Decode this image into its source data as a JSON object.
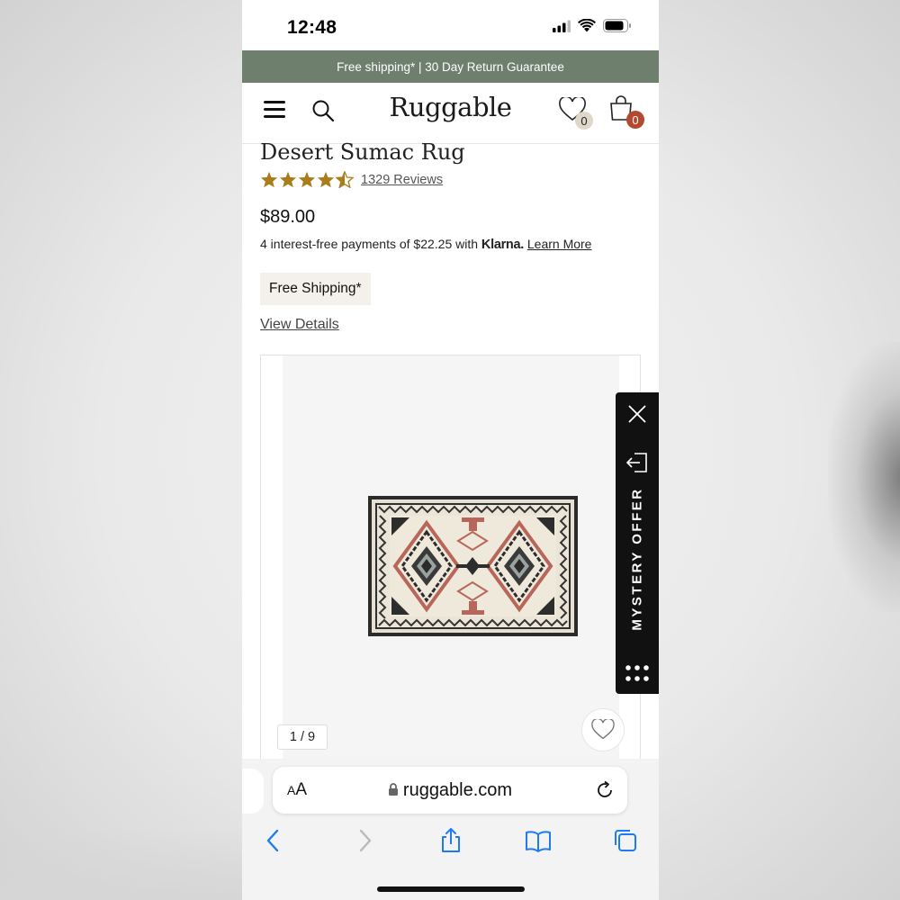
{
  "status": {
    "time": "12:48"
  },
  "announcement": "Free shipping* | 30 Day Return Guarantee",
  "header": {
    "brand": "Ruggable",
    "wishlist_count": "0",
    "cart_count": "0"
  },
  "product": {
    "title": "Desert Sumac Rug",
    "rating": 4.5,
    "reviews": "1329 Reviews",
    "price": "$89.00",
    "klarna_prefix": "4 interest-free payments of $22.25 with",
    "klarna_brand": "Klarna.",
    "klarna_link": "Learn More",
    "shipping_chip": "Free Shipping*",
    "view_details": "View Details"
  },
  "gallery": {
    "page_indicator": "1 / 9"
  },
  "mystery_offer": {
    "label": "MYSTERY OFFER"
  },
  "browser": {
    "aa_small": "A",
    "aa_large": "A",
    "url": "ruggable.com"
  },
  "colors": {
    "announcement_bg": "#6e7f6e",
    "star": "#a97c1c",
    "cart_badge": "#b34a2f",
    "wish_badge": "#ded8c9",
    "ios_blue": "#1e7cf2"
  }
}
